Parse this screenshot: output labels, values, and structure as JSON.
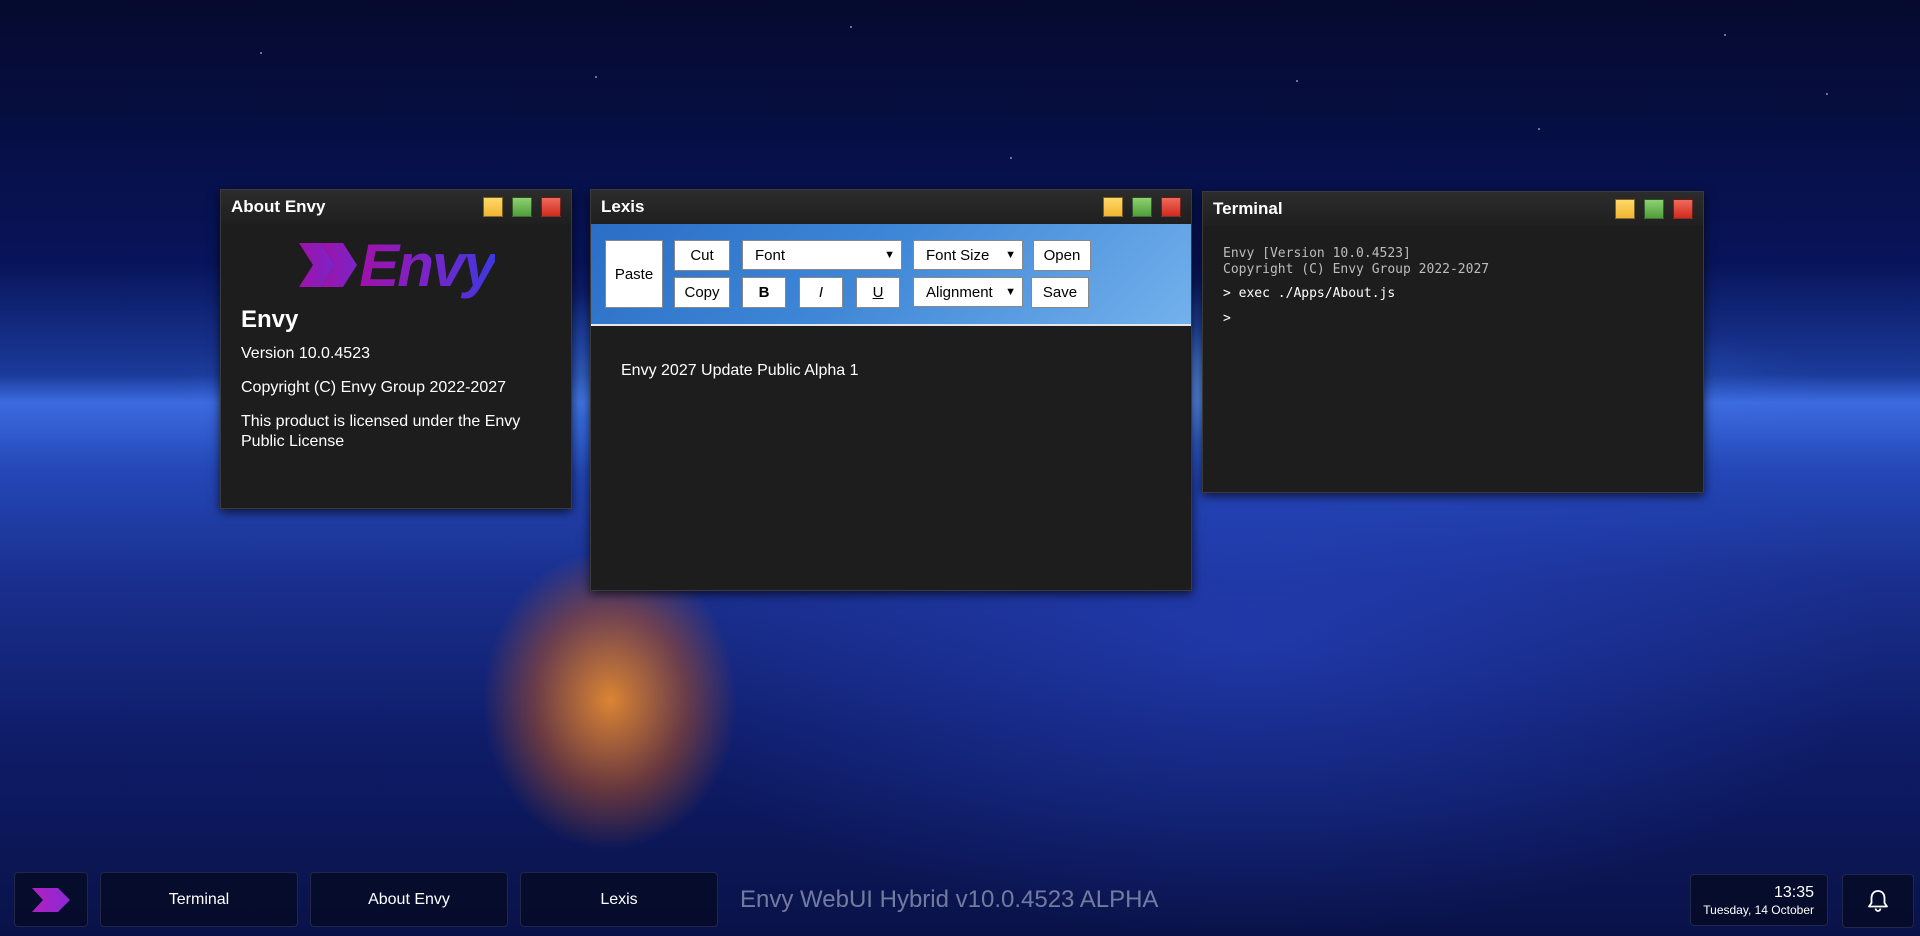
{
  "about_window": {
    "title": "About Envy",
    "logo_text": "Envy",
    "product_name": "Envy",
    "version": "Version 10.0.4523",
    "copyright": "Copyright (C) Envy Group 2022-2027",
    "license": "This product is licensed under the Envy Public License"
  },
  "lexis_window": {
    "title": "Lexis",
    "toolbar": {
      "paste": "Paste",
      "cut": "Cut",
      "copy": "Copy",
      "font": "Font",
      "font_size": "Font Size",
      "alignment": "Alignment",
      "bold": "B",
      "italic": "I",
      "underline": "U",
      "open": "Open",
      "save": "Save"
    },
    "document_text": "Envy 2027 Update Public Alpha 1"
  },
  "terminal_window": {
    "title": "Terminal",
    "header_line1": "Envy [Version 10.0.4523]",
    "header_line2": "Copyright (C) Envy Group 2022-2027",
    "command": "> exec ./Apps/About.js",
    "prompt": ">"
  },
  "taskbar": {
    "items": [
      {
        "label": "Terminal"
      },
      {
        "label": "About Envy"
      },
      {
        "label": "Lexis"
      }
    ],
    "build_label": "Envy WebUI Hybrid v10.0.4523 ALPHA",
    "clock_time": "13:35",
    "clock_date": "Tuesday, 14 October"
  },
  "colors": {
    "window_bg": "#1d1d1d",
    "minimize": "#f2b530",
    "maximize": "#4e9e3a",
    "close": "#d12a1e",
    "brand_start": "#a012a8",
    "brand_end": "#3d38e0"
  },
  "icons": [
    "envy-chevron-icon",
    "bell-icon",
    "chevron-down-icon"
  ]
}
